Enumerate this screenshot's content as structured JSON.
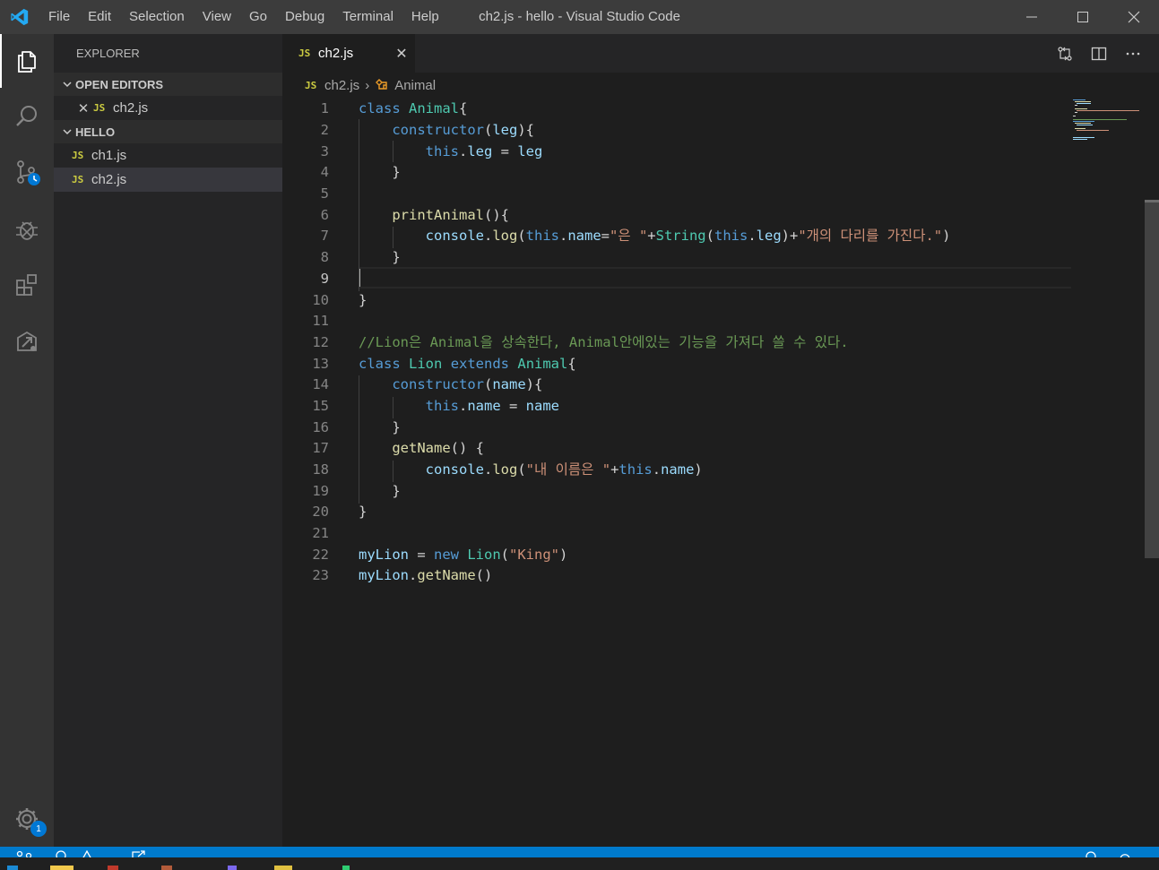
{
  "window": {
    "title": "ch2.js - hello - Visual Studio Code",
    "menu": [
      "File",
      "Edit",
      "Selection",
      "View",
      "Go",
      "Debug",
      "Terminal",
      "Help"
    ]
  },
  "activity_bar": {
    "items": [
      "explorer",
      "search",
      "source-control",
      "debug",
      "extensions",
      "remote-explorer"
    ],
    "settings_badge": "1"
  },
  "sidebar": {
    "header": "EXPLORER",
    "open_editors_label": "OPEN EDITORS",
    "open_editors": [
      {
        "icon": "JS",
        "name": "ch2.js"
      }
    ],
    "folder_label": "HELLO",
    "files": [
      {
        "icon": "JS",
        "name": "ch1.js"
      },
      {
        "icon": "JS",
        "name": "ch2.js"
      }
    ]
  },
  "tabs": [
    {
      "icon": "JS",
      "name": "ch2.js",
      "active": true
    }
  ],
  "breadcrumb": {
    "file_icon": "JS",
    "file": "ch2.js",
    "symbol": "Animal"
  },
  "editor": {
    "line_numbers": [
      "1",
      "2",
      "3",
      "4",
      "5",
      "6",
      "7",
      "8",
      "9",
      "10",
      "11",
      "12",
      "13",
      "14",
      "15",
      "16",
      "17",
      "18",
      "19",
      "20",
      "21",
      "22",
      "23"
    ],
    "current_line": 9,
    "lines": [
      "class Animal{",
      "    constructor(leg){",
      "        this.leg = leg",
      "    }",
      "",
      "    printAnimal(){",
      "        console.log(this.name=\"은 \"+String(this.leg)+\"개의 다리를 가진다.\")",
      "    }",
      "",
      "}",
      "",
      "//Lion은 Animal을 상속한다, Animal안에있는 기능을 가져다 쓸 수 있다.",
      "class Lion extends Animal{",
      "    constructor(name){",
      "        this.name = name",
      "    }",
      "    getName() {",
      "        console.log(\"내 이름은 \"+this.name)",
      "    }",
      "}",
      "",
      "myLion = new Lion(\"King\")",
      "myLion.getName()"
    ]
  },
  "colors": {
    "keyword": "#569cd6",
    "class": "#4ec9b0",
    "function": "#dcdcaa",
    "variable": "#9cdcfe",
    "string": "#ce9178",
    "comment": "#6a9955",
    "statusbar": "#007acc"
  }
}
